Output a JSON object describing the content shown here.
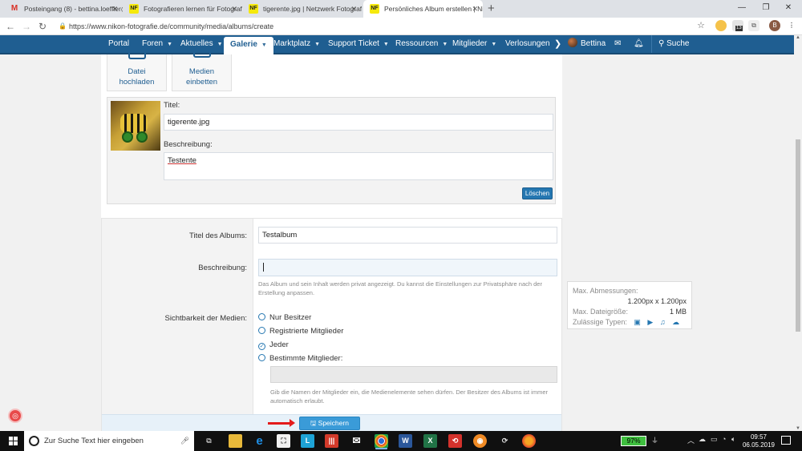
{
  "browser": {
    "tabs": [
      {
        "favicon": "gmail",
        "title": "Posteingang (8) - bettina.loeffler@..."
      },
      {
        "favicon": "NF",
        "title": "Fotografieren lernen für Fotografen..."
      },
      {
        "favicon": "NF",
        "title": "tigerente.jpg | Netzwerk Fotografie"
      },
      {
        "favicon": "NF",
        "title": "Persönliches Album erstellen | Ni..."
      }
    ],
    "new_tab": "+",
    "url": "https://www.nikon-fotografie.de/community/media/albums/create",
    "profile_initial": "B",
    "ext_badge": "13"
  },
  "nav": {
    "items": [
      "Portal",
      "Foren",
      "Aktuelles",
      "Galerie",
      "Marktplatz",
      "Support Ticket",
      "Ressourcen",
      "Mitglieder",
      "Verlosungen"
    ],
    "user": "Bettina",
    "search": "Suche",
    "more": "❯"
  },
  "upload": {
    "file_button": "Datei hochladen",
    "file_line1": "Datei",
    "file_line2": "hochladen",
    "embed_line1": "Medien",
    "embed_line2": "einbetten"
  },
  "media": {
    "title_label": "Titel:",
    "title_value": "tigerente.jpg",
    "description_label": "Beschreibung:",
    "description_value": "Testente",
    "delete_button": "Löschen"
  },
  "album_form": {
    "title_label": "Titel des Albums:",
    "title_value": "Testalbum",
    "description_label": "Beschreibung:",
    "description_value": "",
    "privacy_hint": "Das Album und sein Inhalt werden privat angezeigt. Du kannst die Einstellungen zur Privatsphäre nach der Erstellung anpassen.",
    "visibility_label": "Sichtbarkeit der Medien:",
    "visibility_options": [
      "Nur Besitzer",
      "Registrierte Mitglieder",
      "Jeder",
      "Bestimmte Mitglieder:"
    ],
    "selected_option": "Jeder",
    "members_hint": "Gib die Namen der Mitglieder ein, die Medienelemente sehen dürfen. Der Besitzer des Albums ist immer automatisch erlaubt.",
    "save_button": "Speichern"
  },
  "limits": {
    "dimensions_label": "Max. Abmessungen:",
    "dimensions_value": "1.200px x 1.200px",
    "filesize_label": "Max. Dateigröße:",
    "filesize_value": "1 MB",
    "types_label": "Zulässige Typen:",
    "type_icons": [
      "image-icon",
      "video-icon",
      "audio-icon",
      "embed-icon"
    ]
  },
  "taskbar": {
    "search_placeholder": "Zur Suche Text hier eingeben",
    "battery": "97%",
    "time": "09:57",
    "date": "06.05.2019"
  },
  "colors": {
    "nav_blue": "#1f5e91",
    "button_blue": "#2577b1",
    "save_blue": "#3a9bd8",
    "arrow_red": "#e31b1b"
  }
}
